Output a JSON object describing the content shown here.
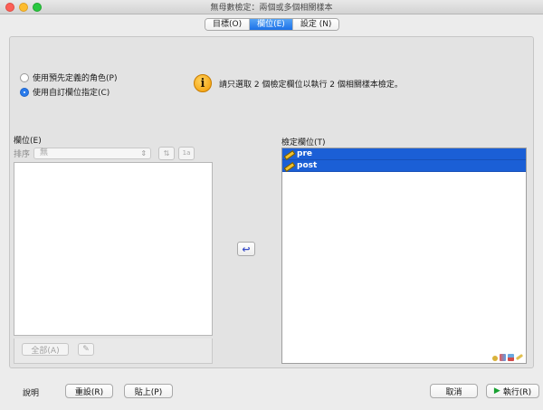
{
  "window": {
    "title": "無母數檢定：兩個或多個相關樣本"
  },
  "tabs": [
    {
      "label": "目標(O)",
      "active": false
    },
    {
      "label": "欄位(E)",
      "active": true
    },
    {
      "label": "設定 (N)",
      "active": false
    }
  ],
  "roles": {
    "option_predefined": "使用預先定義的角色(P)",
    "option_custom": "使用自訂欄位指定(C)",
    "selected": "option_custom"
  },
  "info": {
    "message": "請只選取 2 個檢定欄位以執行 2 個相關樣本檢定。"
  },
  "fields": {
    "label": "欄位(E)",
    "sort_label": "排序",
    "sort_value": "無",
    "items": [],
    "all_button": "全部(A)"
  },
  "test_fields": {
    "label": "檢定欄位(T)",
    "items": [
      {
        "name": "pre",
        "selected": true
      },
      {
        "name": "post",
        "selected": true
      }
    ]
  },
  "footer": {
    "help": "說明",
    "reset": "重設(R)",
    "paste": "貼上(P)",
    "cancel": "取消",
    "run": "執行(R)"
  },
  "colors": {
    "accent": "#1b5fd6",
    "info_icon": "#f39a00",
    "run_icon": "#17a030"
  }
}
